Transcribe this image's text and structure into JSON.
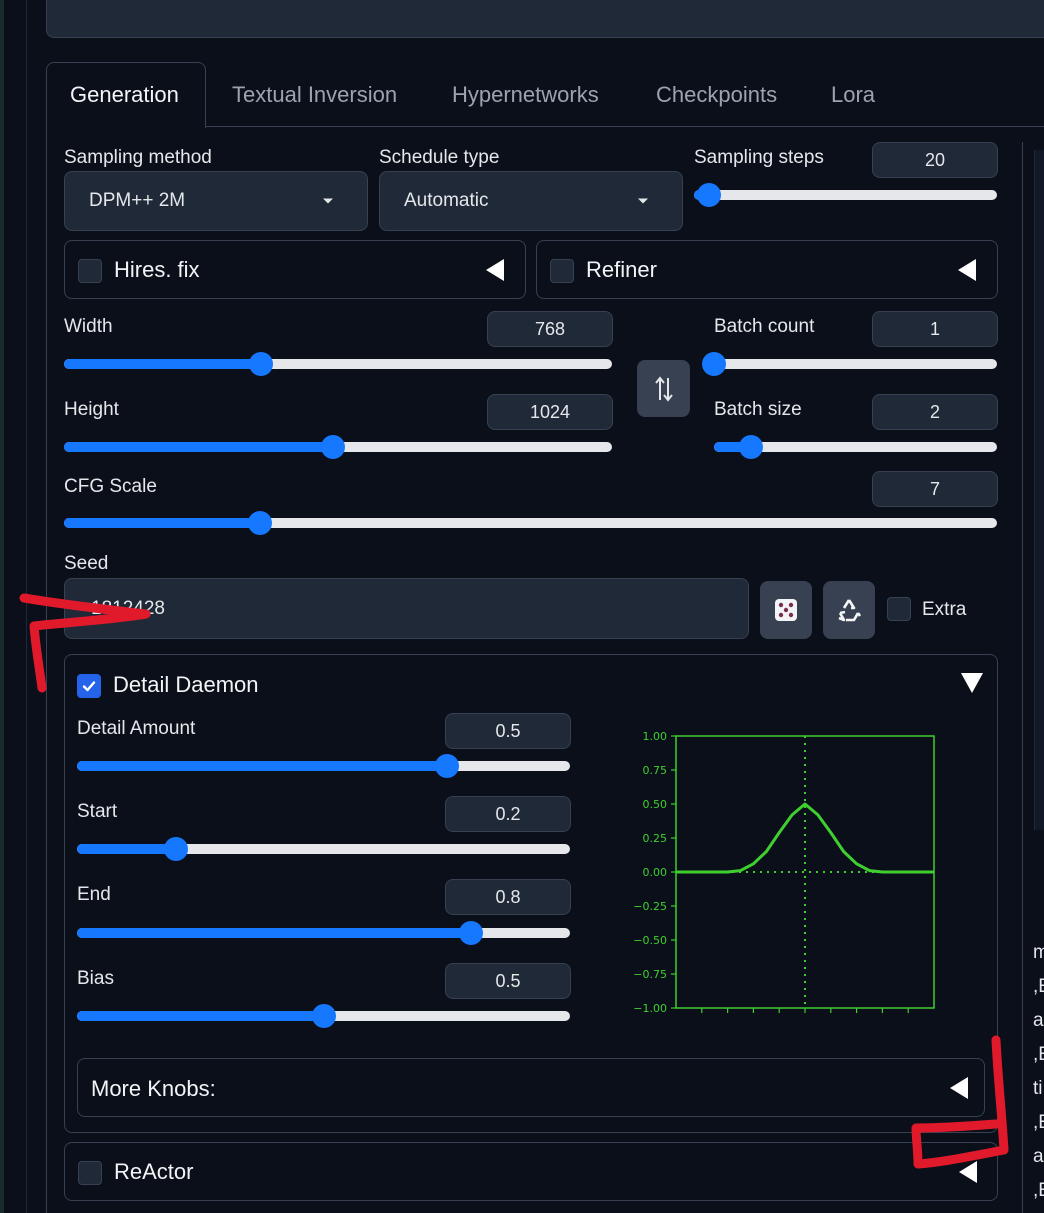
{
  "tabs": [
    {
      "label": "Generation",
      "active": true
    },
    {
      "label": "Textual Inversion",
      "active": false
    },
    {
      "label": "Hypernetworks",
      "active": false
    },
    {
      "label": "Checkpoints",
      "active": false
    },
    {
      "label": "Lora",
      "active": false
    }
  ],
  "sampling": {
    "method_label": "Sampling method",
    "method_value": "DPM++ 2M",
    "schedule_label": "Schedule type",
    "schedule_value": "Automatic",
    "steps_label": "Sampling steps",
    "steps_value": "20",
    "steps_fraction": 0.05
  },
  "hires": {
    "label": "Hires. fix",
    "checked": false
  },
  "refiner": {
    "label": "Refiner",
    "checked": false
  },
  "width": {
    "label": "Width",
    "value": "768",
    "fraction": 0.36
  },
  "height": {
    "label": "Height",
    "value": "1024",
    "fraction": 0.49
  },
  "batch_count": {
    "label": "Batch count",
    "value": "1",
    "fraction": 0.0
  },
  "batch_size": {
    "label": "Batch size",
    "value": "2",
    "fraction": 0.13
  },
  "cfg": {
    "label": "CFG Scale",
    "value": "7",
    "fraction": 0.21
  },
  "seed": {
    "label": "Seed",
    "value": "1812428",
    "extra_label": "Extra"
  },
  "detail_daemon": {
    "title": "Detail Daemon",
    "checked": true,
    "params": [
      {
        "label": "Detail Amount",
        "value": "0.5",
        "fraction": 0.75
      },
      {
        "label": "Start",
        "value": "0.2",
        "fraction": 0.2
      },
      {
        "label": "End",
        "value": "0.8",
        "fraction": 0.8
      },
      {
        "label": "Bias",
        "value": "0.5",
        "fraction": 0.5
      }
    ],
    "more_knobs": "More Knobs:"
  },
  "reactor": {
    "label": "ReActor",
    "checked": false
  },
  "right_panel_text": [
    "m",
    ",E",
    "a",
    ",E",
    "ti",
    ",E",
    "a",
    ",E"
  ],
  "colors": {
    "accent": "#1677ff",
    "plot_green": "#3fcf2f",
    "annotation_red": "#e0192b"
  },
  "chart_data": {
    "type": "line",
    "title": "",
    "xlabel": "",
    "ylabel": "",
    "yticks": [
      "1.00",
      "0.75",
      "0.50",
      "0.25",
      "0.00",
      "−0.25",
      "−0.50",
      "−0.75",
      "−1.00"
    ],
    "ylim": [
      -1.0,
      1.0
    ],
    "xlim": [
      0,
      1
    ],
    "series": [
      {
        "x": [
          0,
          0.1,
          0.2,
          0.25,
          0.3,
          0.35,
          0.4,
          0.45,
          0.5,
          0.55,
          0.6,
          0.65,
          0.7,
          0.75,
          0.8,
          0.9,
          1.0
        ],
        "values": [
          0,
          0,
          0,
          0.01,
          0.06,
          0.15,
          0.29,
          0.42,
          0.5,
          0.42,
          0.29,
          0.15,
          0.06,
          0.01,
          0,
          0,
          0
        ]
      }
    ],
    "guides": {
      "x": 0.5,
      "y": 0
    },
    "grid": false
  }
}
